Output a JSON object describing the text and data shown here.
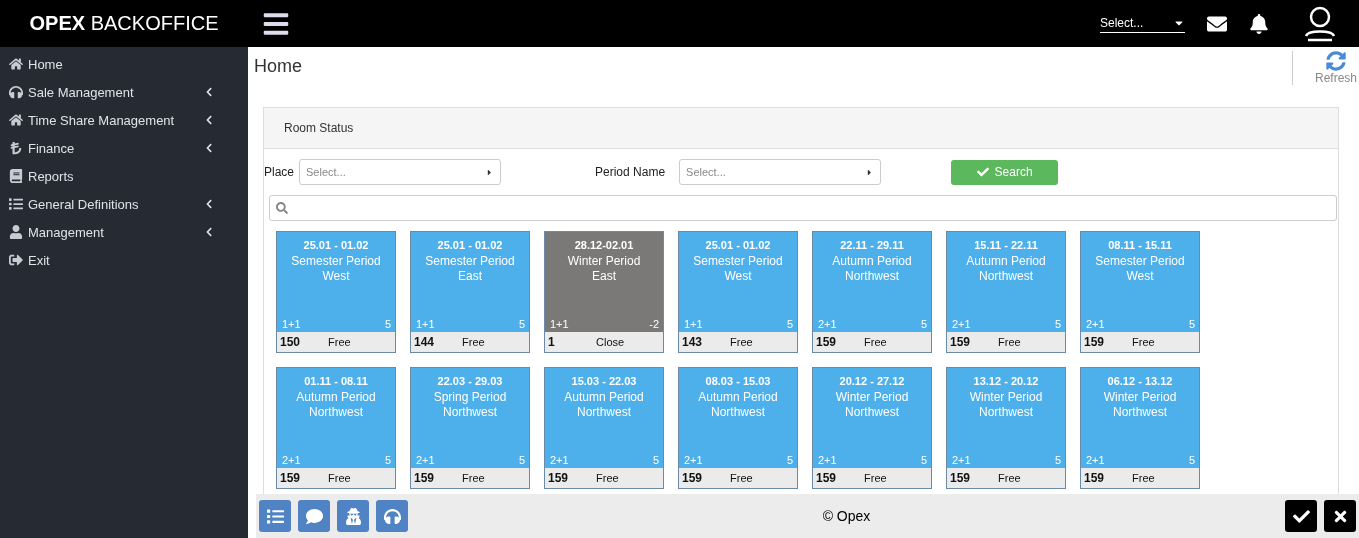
{
  "brand": {
    "bold": "OPEX",
    "light": "BACKOFFICE"
  },
  "header": {
    "select_placeholder": "Select..."
  },
  "sidebar": {
    "items": [
      {
        "label": "Home",
        "kind": "link"
      },
      {
        "label": "Sale Management",
        "kind": "menu"
      },
      {
        "label": "Time Share Management",
        "kind": "menu"
      },
      {
        "label": "Finance",
        "kind": "menu"
      },
      {
        "label": "Reports",
        "kind": "link"
      },
      {
        "label": "General Definitions",
        "kind": "menu"
      },
      {
        "label": "Management",
        "kind": "menu"
      },
      {
        "label": "Exit",
        "kind": "link"
      }
    ]
  },
  "page": {
    "title": "Home",
    "refresh": "Refresh"
  },
  "panel": {
    "title": "Room Status",
    "filters": [
      {
        "label": "Place",
        "placeholder": "Select..."
      },
      {
        "label": "Period Name",
        "placeholder": "Select..."
      }
    ],
    "search_button": "Search",
    "rooms": [
      {
        "dates": "25.01 - 01.02",
        "period": "Semester Period",
        "place": "West",
        "type": "1+1",
        "count": "5",
        "number": "150",
        "status": "Free",
        "kind": "free"
      },
      {
        "dates": "25.01 - 01.02",
        "period": "Semester Period",
        "place": "East",
        "type": "1+1",
        "count": "5",
        "number": "144",
        "status": "Free",
        "kind": "free"
      },
      {
        "dates": "28.12-02.01",
        "period": "Winter Period",
        "place": "East",
        "type": "1+1",
        "count": "-2",
        "number": "1",
        "status": "Close",
        "kind": "close"
      },
      {
        "dates": "25.01 - 01.02",
        "period": "Semester Period",
        "place": "West",
        "type": "1+1",
        "count": "5",
        "number": "143",
        "status": "Free",
        "kind": "free"
      },
      {
        "dates": "22.11 - 29.11",
        "period": "Autumn  Period",
        "place": "Northwest",
        "type": "2+1",
        "count": "5",
        "number": "159",
        "status": "Free",
        "kind": "free"
      },
      {
        "dates": "15.11 - 22.11",
        "period": "Autumn Period",
        "place": "Northwest",
        "type": "2+1",
        "count": "5",
        "number": "159",
        "status": "Free",
        "kind": "free"
      },
      {
        "dates": "08.11 - 15.11",
        "period": "Semester Period",
        "place": "West",
        "type": "2+1",
        "count": "5",
        "number": "159",
        "status": "Free",
        "kind": "free"
      },
      {
        "dates": "01.11 - 08.11",
        "period": "Autumn Period",
        "place": "Northwest",
        "type": "2+1",
        "count": "5",
        "number": "159",
        "status": "Free",
        "kind": "free"
      },
      {
        "dates": "22.03 - 29.03",
        "period": "Spring Period",
        "place": "Northwest",
        "type": "2+1",
        "count": "5",
        "number": "159",
        "status": "Free",
        "kind": "free"
      },
      {
        "dates": "15.03 - 22.03",
        "period": "Autumn Period",
        "place": "Northwest",
        "type": "2+1",
        "count": "5",
        "number": "159",
        "status": "Free",
        "kind": "free"
      },
      {
        "dates": "08.03 - 15.03",
        "period": "Autumn Period",
        "place": "Northwest",
        "type": "2+1",
        "count": "5",
        "number": "159",
        "status": "Free",
        "kind": "free"
      },
      {
        "dates": "20.12 - 27.12",
        "period": "Winter Period",
        "place": "Northwest",
        "type": "2+1",
        "count": "5",
        "number": "159",
        "status": "Free",
        "kind": "free"
      },
      {
        "dates": "13.12 - 20.12",
        "period": "Winter Period",
        "place": "Northwest",
        "type": "2+1",
        "count": "5",
        "number": "159",
        "status": "Free",
        "kind": "free"
      },
      {
        "dates": "06.12 - 13.12",
        "period": "Winter Period",
        "place": "Northwest",
        "type": "2+1",
        "count": "5",
        "number": "159",
        "status": "Free",
        "kind": "free"
      }
    ]
  },
  "footer": {
    "copyright": "© Opex"
  }
}
